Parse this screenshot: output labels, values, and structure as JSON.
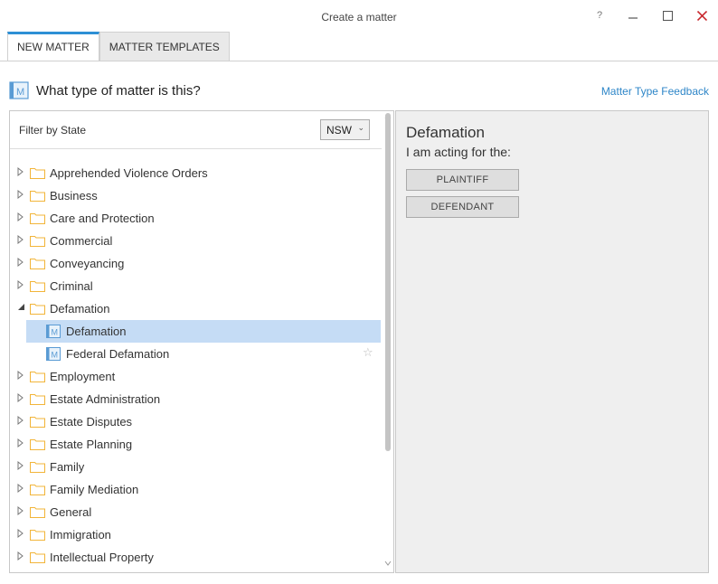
{
  "window": {
    "title": "Create a matter",
    "help_glyph": "?",
    "minimize_glyph": "—",
    "maximize_glyph": "☐",
    "close_glyph": "✕"
  },
  "tabs": [
    {
      "label": "NEW MATTER",
      "active": true
    },
    {
      "label": "MATTER TEMPLATES",
      "active": false
    }
  ],
  "header": {
    "question": "What type of matter is this?",
    "feedback_link": "Matter Type Feedback",
    "icon": "matter-type-icon"
  },
  "filter": {
    "label": "Filter by State",
    "selected_state": "NSW"
  },
  "tree": {
    "items": [
      {
        "label": "Apprehended Violence Orders",
        "expanded": false
      },
      {
        "label": "Business",
        "expanded": false
      },
      {
        "label": "Care and Protection",
        "expanded": false
      },
      {
        "label": "Commercial",
        "expanded": false
      },
      {
        "label": "Conveyancing",
        "expanded": false
      },
      {
        "label": "Criminal",
        "expanded": false
      },
      {
        "label": "Defamation",
        "expanded": true
      },
      {
        "label": "Employment",
        "expanded": false
      },
      {
        "label": "Estate Administration",
        "expanded": false
      },
      {
        "label": "Estate Disputes",
        "expanded": false
      },
      {
        "label": "Estate Planning",
        "expanded": false
      },
      {
        "label": "Family",
        "expanded": false
      },
      {
        "label": "Family Mediation",
        "expanded": false
      },
      {
        "label": "General",
        "expanded": false
      },
      {
        "label": "Immigration",
        "expanded": false
      },
      {
        "label": "Intellectual Property",
        "expanded": false
      }
    ],
    "defamation_children": [
      {
        "label": "Defamation",
        "selected": true
      },
      {
        "label": "Federal Defamation",
        "selected": false
      }
    ]
  },
  "detail": {
    "title": "Defamation",
    "subtitle": "I am acting for the:",
    "plaintiff_button": "PLAINTIFF",
    "defendant_button": "DEFENDANT"
  },
  "colors": {
    "accent": "#2d8fd5",
    "link": "#2e86c8",
    "selection": "#c5dcf5",
    "folder": "#f2b53a",
    "close": "#c8262c"
  }
}
